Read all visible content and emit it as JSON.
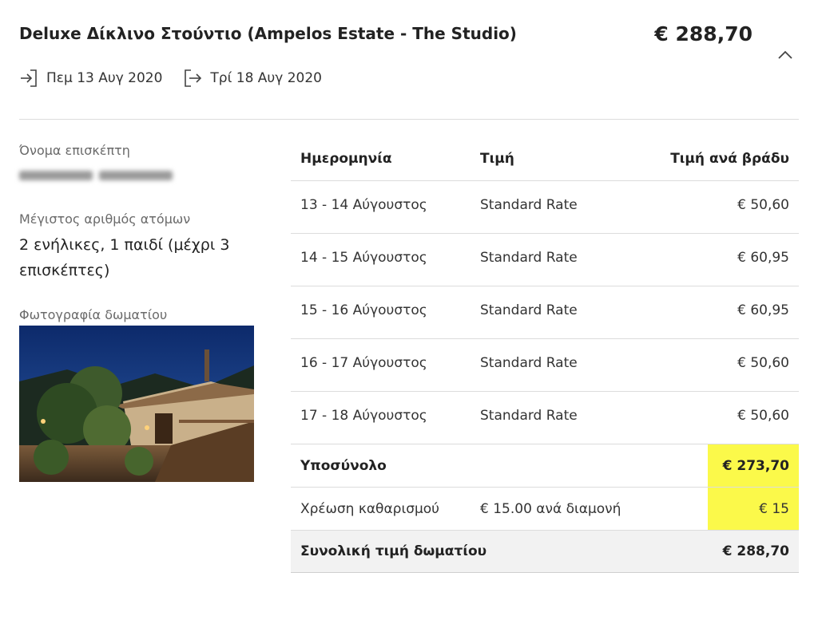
{
  "booking": {
    "room_title": "Deluxe Δίκλινο Στούντιο (Ampelos Estate - The Studio)",
    "price": "€ 288,70",
    "checkin": "Πεμ 13 Αυγ 2020",
    "checkout": "Τρί 18 Αυγ 2020",
    "collapse_icon": "chevron-up-icon",
    "checkin_icon": "arrow-into-door-icon",
    "checkout_icon": "arrow-out-door-icon"
  },
  "guest": {
    "name_label": "Όνομα επισκέπτη",
    "max_people_label": "Μέγιστος αριθμός ατόμων",
    "max_people_value": "2 ενήλικες, 1 παιδί (μέχρι 3 επισκέπτες)",
    "photo_label": "Φωτογραφία δωματίου"
  },
  "rates": {
    "headers": {
      "date": "Ημερομηνία",
      "rate": "Τιμή",
      "per_night": "Τιμή ανά βράδυ"
    },
    "rows": [
      {
        "date": "13 - 14 Αύγουστος",
        "rate": "Standard Rate",
        "price": "€ 50,60"
      },
      {
        "date": "14 - 15 Αύγουστος",
        "rate": "Standard Rate",
        "price": "€ 60,95"
      },
      {
        "date": "15 - 16 Αύγουστος",
        "rate": "Standard Rate",
        "price": "€ 60,95"
      },
      {
        "date": "16 - 17 Αύγουστος",
        "rate": "Standard Rate",
        "price": "€ 50,60"
      },
      {
        "date": "17 - 18 Αύγουστος",
        "rate": "Standard Rate",
        "price": "€ 50,60"
      }
    ],
    "subtotal_label": "Υποσύνολο",
    "subtotal_value": "€ 273,70",
    "cleaning_label": "Χρέωση καθαρισμού",
    "cleaning_rate": "€ 15.00 ανά διαμονή",
    "cleaning_value": "€ 15",
    "total_label": "Συνολική τιμή δωματίου",
    "total_value": "€ 288,70"
  },
  "colors": {
    "highlight": "#fbf94a",
    "divider": "#dcdcdc",
    "total_bg": "#f2f2f2"
  }
}
